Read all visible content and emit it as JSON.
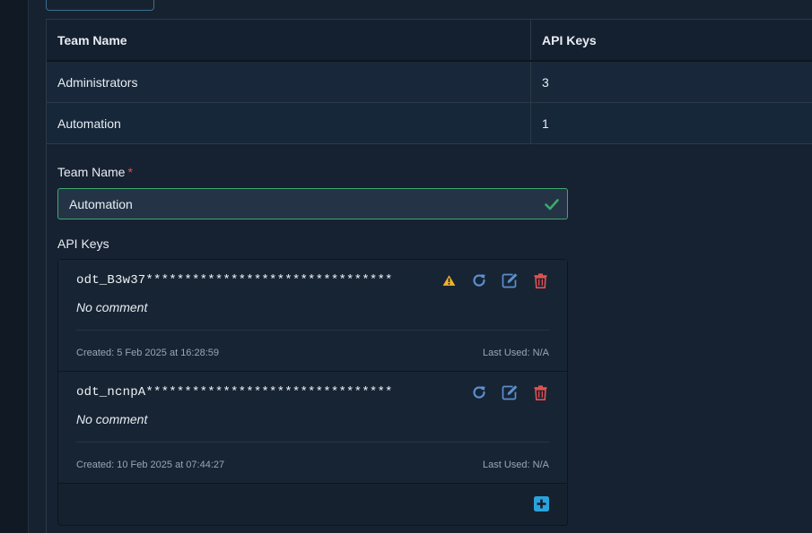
{
  "colors": {
    "accent": "#2aa3dc",
    "success": "#3fa86b",
    "warning": "#f0b429",
    "danger": "#e05252",
    "refresh": "#5b8fcf",
    "edit": "#5b8fcf"
  },
  "table": {
    "headers": {
      "team_name": "Team Name",
      "api_keys": "API Keys"
    },
    "rows": [
      {
        "team_name": "Administrators",
        "api_keys": "3"
      },
      {
        "team_name": "Automation",
        "api_keys": "1"
      }
    ]
  },
  "form": {
    "team_name_label": "Team Name",
    "required_mark": "*",
    "team_name_value": "Automation",
    "api_keys_label": "API Keys"
  },
  "api_keys": [
    {
      "key": "odt_B3w37********************************",
      "comment": "No comment",
      "created": "Created: 5 Feb 2025 at 16:28:59",
      "last_used": "Last Used: N/A",
      "icons": [
        "warning-icon",
        "refresh-icon",
        "edit-icon",
        "trash-icon"
      ]
    },
    {
      "key": "odt_ncnpA********************************",
      "comment": "No comment",
      "created": "Created: 10 Feb 2025 at 07:44:27",
      "last_used": "Last Used: N/A",
      "icons": [
        "refresh-icon",
        "edit-icon",
        "trash-icon"
      ]
    }
  ],
  "add_icon": "plus-square-icon"
}
